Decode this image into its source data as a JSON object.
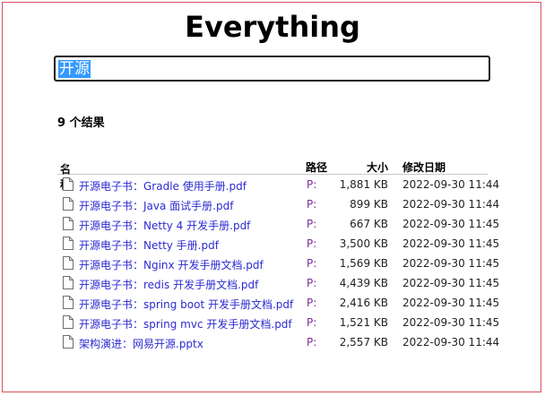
{
  "app": {
    "title": "Everything"
  },
  "search": {
    "value": "开源"
  },
  "results": {
    "count_label": "9 个结果"
  },
  "columns": {
    "name": "名称",
    "path": "路径",
    "size": "大小",
    "date": "修改日期"
  },
  "rows": [
    {
      "name": "开源电子书：Gradle 使用手册.pdf",
      "path": "P:",
      "size": "1,881 KB",
      "date": "2022-09-30 11:44"
    },
    {
      "name": "开源电子书：Java 面试手册.pdf",
      "path": "P:",
      "size": "899 KB",
      "date": "2022-09-30 11:44"
    },
    {
      "name": "开源电子书：Netty 4 开发手册.pdf",
      "path": "P:",
      "size": "667 KB",
      "date": "2022-09-30 11:45"
    },
    {
      "name": "开源电子书：Netty 手册.pdf",
      "path": "P:",
      "size": "3,500 KB",
      "date": "2022-09-30 11:45"
    },
    {
      "name": "开源电子书：Nginx 开发手册文档.pdf",
      "path": "P:",
      "size": "1,569 KB",
      "date": "2022-09-30 11:45"
    },
    {
      "name": "开源电子书：redis 开发手册文档.pdf",
      "path": "P:",
      "size": "4,439 KB",
      "date": "2022-09-30 11:45"
    },
    {
      "name": "开源电子书：spring boot 开发手册文档.pdf",
      "path": "P:",
      "size": "2,416 KB",
      "date": "2022-09-30 11:45"
    },
    {
      "name": "开源电子书：spring mvc 开发手册文档.pdf",
      "path": "P:",
      "size": "1,521 KB",
      "date": "2022-09-30 11:45"
    },
    {
      "name": "架构演进：网易开源.pptx",
      "path": "P:",
      "size": "2,557 KB",
      "date": "2022-09-30 11:44"
    }
  ],
  "icons": {
    "file": "file-icon",
    "sort": "sort-ascending-icon"
  },
  "colors": {
    "link": "#2b2bd1",
    "path": "#7a2b9a",
    "selection": "#3399ff",
    "border": "#d9525e"
  }
}
